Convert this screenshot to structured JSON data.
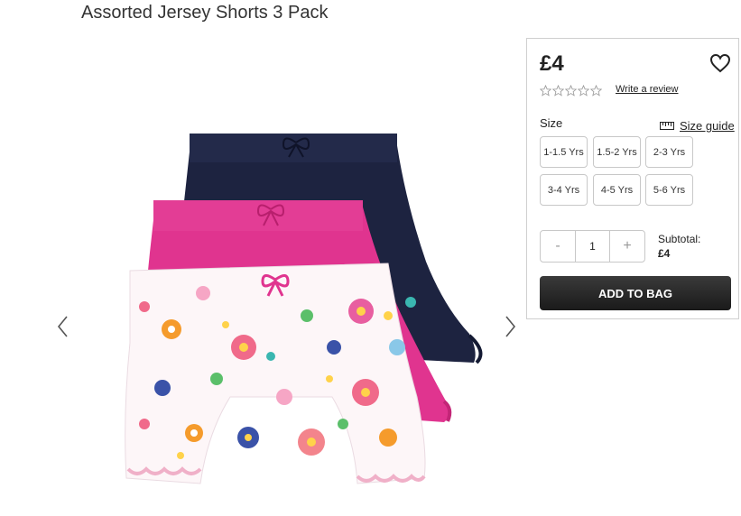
{
  "product": {
    "title": "Assorted Jersey Shorts 3 Pack",
    "price": "£4",
    "write_review": "Write a review",
    "rating": 0,
    "size_label": "Size",
    "size_guide": "Size guide",
    "sizes": [
      "1-1.5 Yrs",
      "1.5-2 Yrs",
      "2-3 Yrs",
      "3-4 Yrs",
      "4-5 Yrs",
      "5-6 Yrs"
    ],
    "quantity": {
      "minus": "-",
      "value": "1",
      "plus": "+"
    },
    "subtotal_label": "Subtotal:",
    "subtotal_value": "£4",
    "add_to_bag": "ADD TO BAG"
  },
  "icons": {
    "heart": "heart-icon",
    "star": "star-icon",
    "ruler": "ruler-icon",
    "prev": "chevron-left-icon",
    "next": "chevron-right-icon"
  },
  "colors": {
    "navy_shorts": "#1d2340",
    "pink_shorts": "#e0348f",
    "button_bg": "#222222"
  }
}
